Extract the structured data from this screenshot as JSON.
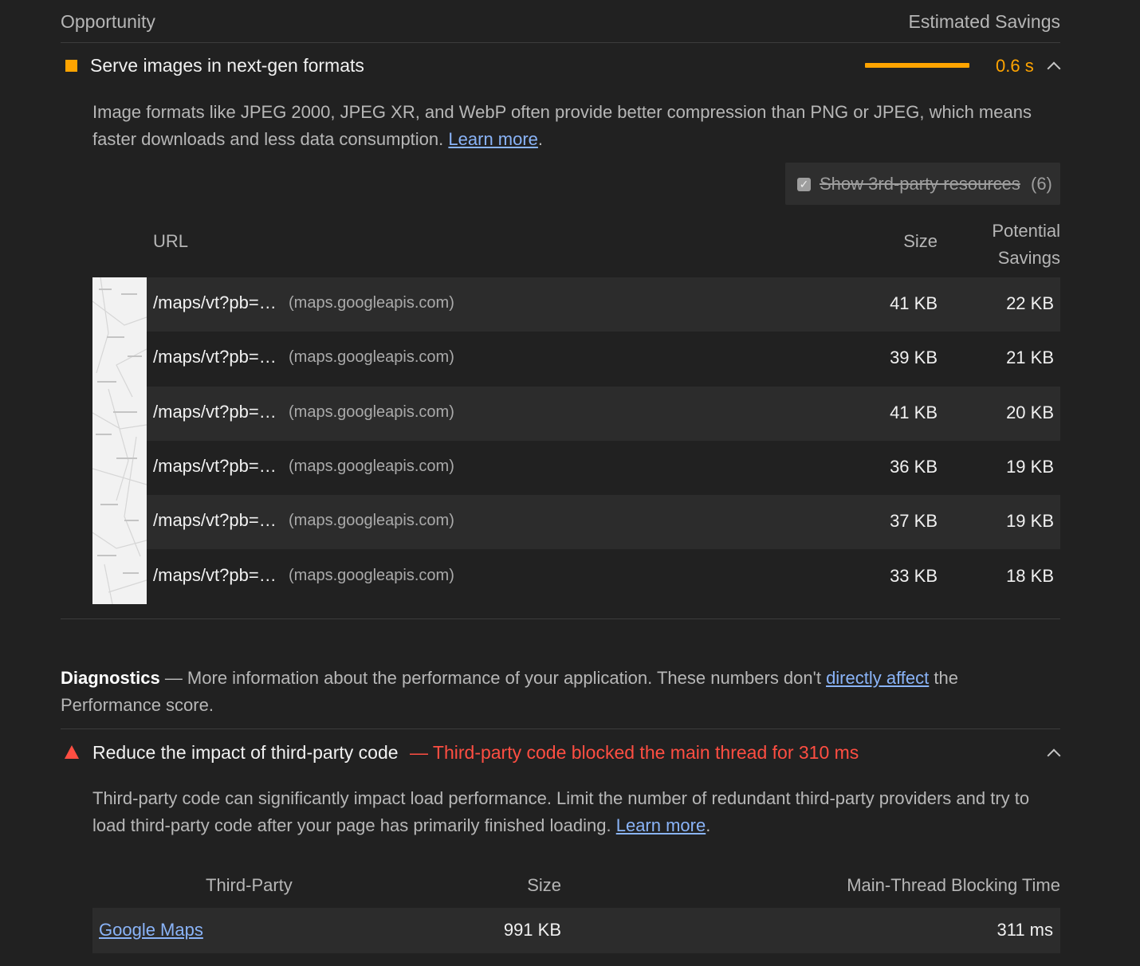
{
  "opportunity_header": {
    "left": "Opportunity",
    "right": "Estimated Savings"
  },
  "audit1": {
    "title": "Serve images in next-gen formats",
    "savings": "0.6 s",
    "status_color": "#ffa400",
    "description": "Image formats like JPEG 2000, JPEG XR, and WebP often provide better compression than PNG or JPEG, which means faster downloads and less data consumption.",
    "learn_more": "Learn more",
    "toggle_label": "Show 3rd-party resources",
    "toggle_count": "(6)",
    "columns": {
      "url": "URL",
      "size": "Size",
      "savings_line1": "Potential",
      "savings_line2": "Savings"
    },
    "rows": [
      {
        "url": "/maps/vt?pb=…",
        "host": "(maps.googleapis.com)",
        "size": "41 KB",
        "savings": "22 KB"
      },
      {
        "url": "/maps/vt?pb=…",
        "host": "(maps.googleapis.com)",
        "size": "39 KB",
        "savings": "21 KB"
      },
      {
        "url": "/maps/vt?pb=…",
        "host": "(maps.googleapis.com)",
        "size": "41 KB",
        "savings": "20 KB"
      },
      {
        "url": "/maps/vt?pb=…",
        "host": "(maps.googleapis.com)",
        "size": "36 KB",
        "savings": "19 KB"
      },
      {
        "url": "/maps/vt?pb=…",
        "host": "(maps.googleapis.com)",
        "size": "37 KB",
        "savings": "19 KB"
      },
      {
        "url": "/maps/vt?pb=…",
        "host": "(maps.googleapis.com)",
        "size": "33 KB",
        "savings": "18 KB"
      }
    ]
  },
  "diagnostics": {
    "title": "Diagnostics",
    "text_before": " — More information about the performance of your application. These numbers don't ",
    "link": "directly affect",
    "text_after": " the",
    "text_line2": "Performance score."
  },
  "audit2": {
    "title": "Reduce the impact of third-party code",
    "summary": "— Third-party code blocked the main thread for 310 ms",
    "status_color": "#ff4e42",
    "description": "Third-party code can significantly impact load performance. Limit the number of redundant third-party providers and try to load third-party code after your page has primarily finished loading.",
    "learn_more": "Learn more",
    "columns": {
      "party": "Third-Party",
      "size": "Size",
      "blocking": "Main-Thread Blocking Time"
    },
    "rows": [
      {
        "party": "Google Maps",
        "size": "991 KB",
        "blocking": "311 ms"
      }
    ]
  }
}
